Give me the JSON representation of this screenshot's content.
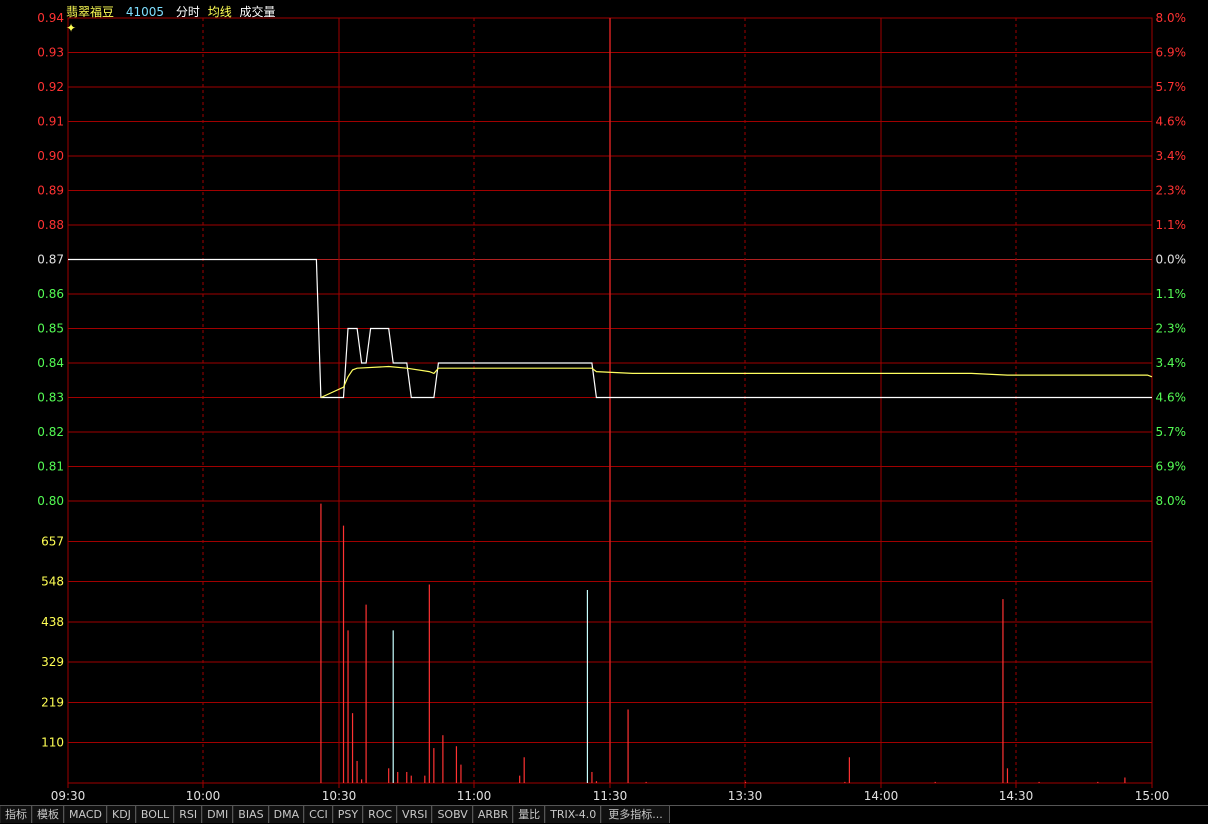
{
  "header": {
    "name": "翡翠福豆",
    "code": "41005",
    "labels": [
      "分时",
      "均线",
      "成交量"
    ]
  },
  "toolbar": [
    "指标",
    "模板",
    "MACD",
    "KDJ",
    "BOLL",
    "RSI",
    "DMI",
    "BIAS",
    "DMA",
    "CCI",
    "PSY",
    "ROC",
    "VRSI",
    "SOBV",
    "ARBR",
    "量比",
    "TRIX-4.0",
    "更多指标..."
  ],
  "colors": {
    "up": "#ff3232",
    "down": "#54fc54",
    "flat": "#e0e0e0",
    "vol_axis": "#ffff54",
    "grid": "#a00000",
    "price_line": "#ffffff",
    "avg_line": "#ffff60",
    "header_code": "#7fdfff",
    "header_text": "#ffff54"
  },
  "chart_data": [
    {
      "type": "line",
      "name": "intraday-price",
      "prev_close": 0.87,
      "ylim": [
        0.8,
        0.94
      ],
      "y_ticks": [
        "0.94",
        "0.93",
        "0.92",
        "0.91",
        "0.90",
        "0.89",
        "0.88",
        "0.87",
        "0.86",
        "0.85",
        "0.84",
        "0.83",
        "0.82",
        "0.81",
        "0.80"
      ],
      "pct_ticks": [
        "8.0%",
        "6.9%",
        "5.7%",
        "4.6%",
        "3.4%",
        "2.3%",
        "1.1%",
        "0.0%",
        "1.1%",
        "2.3%",
        "3.4%",
        "4.6%",
        "5.7%",
        "6.9%",
        "8.0%"
      ],
      "x_ticks": [
        "09:30",
        "10:00",
        "10:30",
        "11:00",
        "11:30",
        "13:30",
        "14:00",
        "14:30",
        "15:00"
      ],
      "minutes_total": 240,
      "series": [
        {
          "points": [
            [
              0,
              0.87
            ],
            [
              55,
              0.87
            ],
            [
              56,
              0.83
            ],
            [
              61,
              0.83
            ],
            [
              62,
              0.85
            ],
            [
              64,
              0.85
            ],
            [
              65,
              0.84
            ],
            [
              66,
              0.84
            ],
            [
              67,
              0.85
            ],
            [
              71,
              0.85
            ],
            [
              72,
              0.84
            ],
            [
              75,
              0.84
            ],
            [
              76,
              0.83
            ],
            [
              81,
              0.83
            ],
            [
              82,
              0.84
            ],
            [
              116,
              0.84
            ],
            [
              117,
              0.83
            ],
            [
              240,
              0.83
            ]
          ]
        },
        {
          "points": [
            [
              56,
              0.83
            ],
            [
              61,
              0.833
            ],
            [
              62,
              0.836
            ],
            [
              63,
              0.838
            ],
            [
              64,
              0.8385
            ],
            [
              71,
              0.839
            ],
            [
              75,
              0.8385
            ],
            [
              80,
              0.8375
            ],
            [
              81,
              0.837
            ],
            [
              82,
              0.8385
            ],
            [
              116,
              0.8385
            ],
            [
              117,
              0.8375
            ],
            [
              125,
              0.837
            ],
            [
              150,
              0.837
            ],
            [
              200,
              0.837
            ],
            [
              208,
              0.8365
            ],
            [
              239,
              0.8365
            ],
            [
              240,
              0.836
            ]
          ]
        }
      ]
    },
    {
      "type": "bar",
      "name": "volume",
      "ylim": [
        0,
        767
      ],
      "y_ticks": [
        "657",
        "548",
        "438",
        "329",
        "219",
        "110"
      ],
      "bars": [
        {
          "m": 56,
          "v": 760,
          "c": "up"
        },
        {
          "m": 61,
          "v": 700,
          "c": "up"
        },
        {
          "m": 62,
          "v": 415,
          "c": "up"
        },
        {
          "m": 63,
          "v": 190,
          "c": "up"
        },
        {
          "m": 64,
          "v": 60,
          "c": "up"
        },
        {
          "m": 65,
          "v": 10,
          "c": "up"
        },
        {
          "m": 66,
          "v": 485,
          "c": "up"
        },
        {
          "m": 71,
          "v": 40,
          "c": "up"
        },
        {
          "m": 72,
          "v": 415,
          "c": "flat"
        },
        {
          "m": 73,
          "v": 30,
          "c": "up"
        },
        {
          "m": 75,
          "v": 30,
          "c": "up"
        },
        {
          "m": 76,
          "v": 20,
          "c": "up"
        },
        {
          "m": 79,
          "v": 20,
          "c": "up"
        },
        {
          "m": 80,
          "v": 540,
          "c": "up"
        },
        {
          "m": 81,
          "v": 95,
          "c": "up"
        },
        {
          "m": 83,
          "v": 130,
          "c": "up"
        },
        {
          "m": 86,
          "v": 100,
          "c": "up"
        },
        {
          "m": 87,
          "v": 50,
          "c": "up"
        },
        {
          "m": 100,
          "v": 20,
          "c": "up"
        },
        {
          "m": 101,
          "v": 70,
          "c": "up"
        },
        {
          "m": 115,
          "v": 525,
          "c": "flat"
        },
        {
          "m": 116,
          "v": 30,
          "c": "up"
        },
        {
          "m": 117,
          "v": 5,
          "c": "up"
        },
        {
          "m": 124,
          "v": 200,
          "c": "up"
        },
        {
          "m": 128,
          "v": 3,
          "c": "up"
        },
        {
          "m": 150,
          "v": 3,
          "c": "up"
        },
        {
          "m": 172,
          "v": 3,
          "c": "up"
        },
        {
          "m": 173,
          "v": 70,
          "c": "up"
        },
        {
          "m": 192,
          "v": 3,
          "c": "up"
        },
        {
          "m": 207,
          "v": 500,
          "c": "up"
        },
        {
          "m": 208,
          "v": 40,
          "c": "up"
        },
        {
          "m": 215,
          "v": 3,
          "c": "up"
        },
        {
          "m": 228,
          "v": 3,
          "c": "up"
        },
        {
          "m": 234,
          "v": 15,
          "c": "up"
        }
      ]
    }
  ]
}
